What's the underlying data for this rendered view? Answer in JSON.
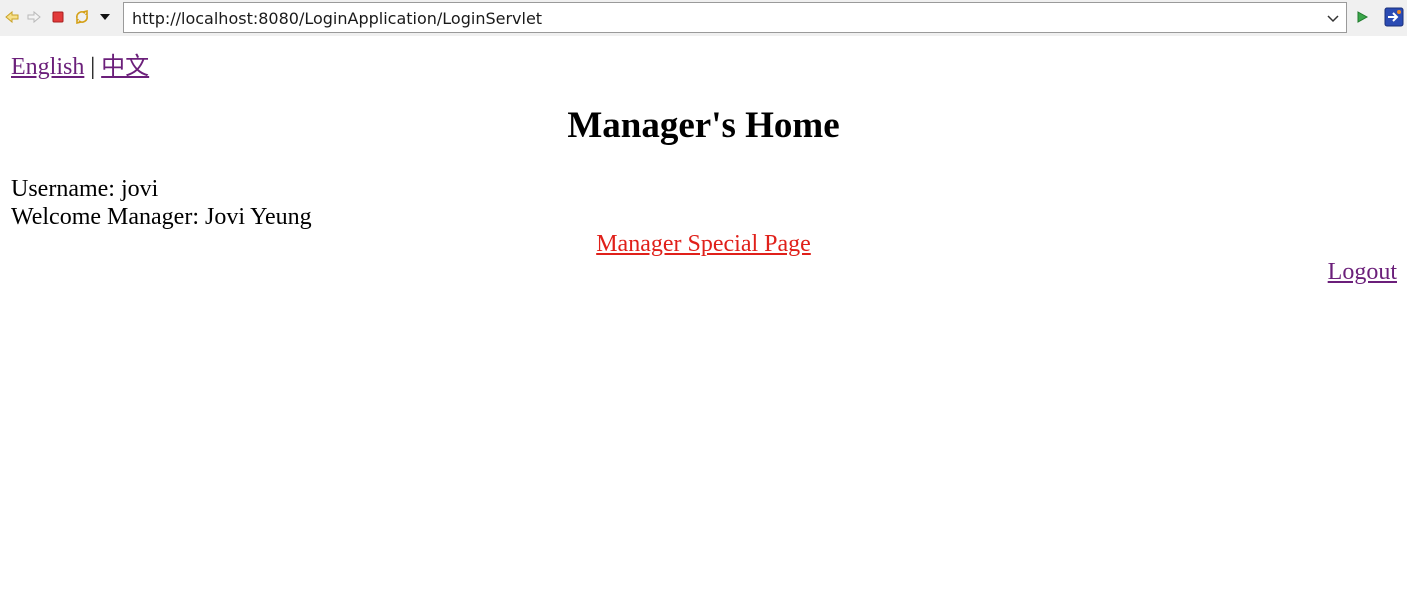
{
  "browser": {
    "url": "http://localhost:8080/LoginApplication/LoginServlet",
    "icons": [
      "back-icon",
      "forward-icon",
      "stop-icon",
      "refresh-icon",
      "menu-dropdown-icon",
      "url-dropdown-icon",
      "go-icon",
      "external-browser-icon"
    ]
  },
  "language": {
    "english": "English",
    "separator": "|",
    "chinese": "中文"
  },
  "page": {
    "title": "Manager's Home",
    "username_line": "Username: jovi",
    "welcome_line": "Welcome Manager: Jovi Yeung",
    "special_link": "Manager Special Page",
    "logout": "Logout"
  },
  "colors": {
    "visited_link": "#6b1f7a",
    "special_link": "#e0201a",
    "toolbar_bg": "#f0f0f0"
  }
}
